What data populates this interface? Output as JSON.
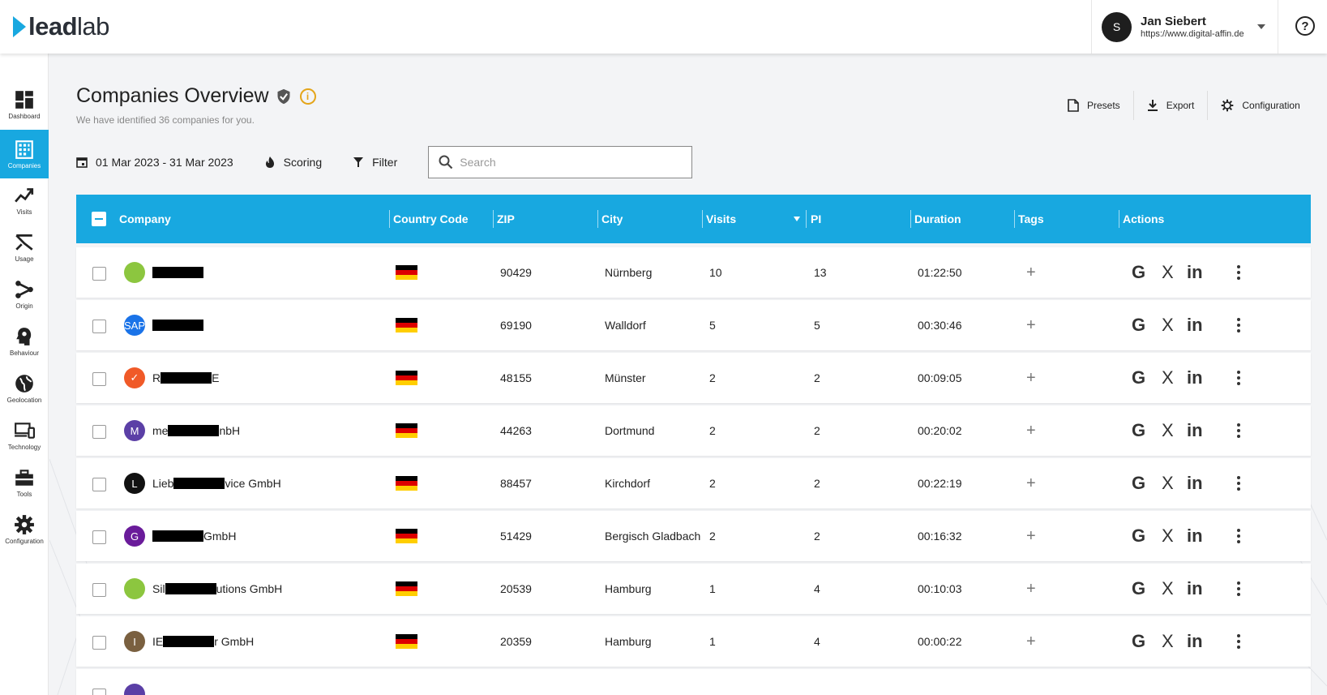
{
  "app": {
    "logo_bold": "lead",
    "logo_light": "lab",
    "user_initial": "S",
    "user_name": "Jan Siebert",
    "user_url": "https://www.digital-affin.de",
    "help_label": "?"
  },
  "sidebar": {
    "items": [
      {
        "label": "Dashboard",
        "icon": "dashboard-icon",
        "active": false
      },
      {
        "label": "Companies",
        "icon": "companies-icon",
        "active": true
      },
      {
        "label": "Visits",
        "icon": "visits-icon",
        "active": false
      },
      {
        "label": "Usage",
        "icon": "usage-icon",
        "active": false
      },
      {
        "label": "Origin",
        "icon": "origin-icon",
        "active": false
      },
      {
        "label": "Behaviour",
        "icon": "behaviour-icon",
        "active": false
      },
      {
        "label": "Geolocation",
        "icon": "globe-icon",
        "active": false
      },
      {
        "label": "Technology",
        "icon": "devices-icon",
        "active": false
      },
      {
        "label": "Tools",
        "icon": "toolbox-icon",
        "active": false
      },
      {
        "label": "Configuration",
        "icon": "gear-icon",
        "active": false
      }
    ]
  },
  "page": {
    "title": "Companies Overview",
    "subtitle": "We have identified 36 companies for you.",
    "info_glyph": "i"
  },
  "actions": {
    "presets": "Presets",
    "export": "Export",
    "configuration": "Configuration"
  },
  "toolbar": {
    "date_range": "01 Mar 2023 - 31 Mar 2023",
    "scoring": "Scoring",
    "filter": "Filter",
    "search_placeholder": "Search"
  },
  "table": {
    "columns": {
      "company": "Company",
      "country": "Country Code",
      "zip": "ZIP",
      "city": "City",
      "visits": "Visits",
      "pi": "PI",
      "duration": "Duration",
      "tags": "Tags",
      "actions": "Actions"
    },
    "action_glyphs": {
      "google": "G",
      "xing": "X",
      "linkedin": "in",
      "add_tag": "+"
    },
    "rows": [
      {
        "logo_letter": "",
        "logo_color": "#8cc63f",
        "name_prefix": "",
        "name_suffix": "",
        "zip": "90429",
        "city": "Nürnberg",
        "visits": "10",
        "pi": "13",
        "duration": "01:22:50"
      },
      {
        "logo_letter": "SAP",
        "logo_color": "#1a73e8",
        "name_prefix": "",
        "name_suffix": "",
        "zip": "69190",
        "city": "Walldorf",
        "visits": "5",
        "pi": "5",
        "duration": "00:30:46"
      },
      {
        "logo_letter": "✓",
        "logo_color": "#f05a28",
        "name_prefix": "R",
        "name_suffix": "E",
        "zip": "48155",
        "city": "Münster",
        "visits": "2",
        "pi": "2",
        "duration": "00:09:05"
      },
      {
        "logo_letter": "M",
        "logo_color": "#5b3fa6",
        "name_prefix": "me",
        "name_suffix": "nbH",
        "zip": "44263",
        "city": "Dortmund",
        "visits": "2",
        "pi": "2",
        "duration": "00:20:02"
      },
      {
        "logo_letter": "L",
        "logo_color": "#111111",
        "name_prefix": "Lieb",
        "name_suffix": "vice GmbH",
        "zip": "88457",
        "city": "Kirchdorf",
        "visits": "2",
        "pi": "2",
        "duration": "00:22:19"
      },
      {
        "logo_letter": "G",
        "logo_color": "#6a1b9a",
        "name_prefix": "",
        "name_suffix": "GmbH",
        "zip": "51429",
        "city": "Bergisch Gladbach",
        "visits": "2",
        "pi": "2",
        "duration": "00:16:32"
      },
      {
        "logo_letter": "",
        "logo_color": "#8cc63f",
        "name_prefix": "Sil",
        "name_suffix": "utions GmbH",
        "zip": "20539",
        "city": "Hamburg",
        "visits": "1",
        "pi": "4",
        "duration": "00:10:03"
      },
      {
        "logo_letter": "I",
        "logo_color": "#7a6040",
        "name_prefix": "IE",
        "name_suffix": "r GmbH",
        "zip": "20359",
        "city": "Hamburg",
        "visits": "1",
        "pi": "4",
        "duration": "00:00:22"
      },
      {
        "logo_letter": "",
        "logo_color": "#5b3fa6",
        "name_prefix": "",
        "name_suffix": "",
        "zip": "",
        "city": "",
        "visits": "",
        "pi": "",
        "duration": ""
      }
    ]
  },
  "colors": {
    "accent": "#18a8e0",
    "info": "#e4a51a"
  }
}
